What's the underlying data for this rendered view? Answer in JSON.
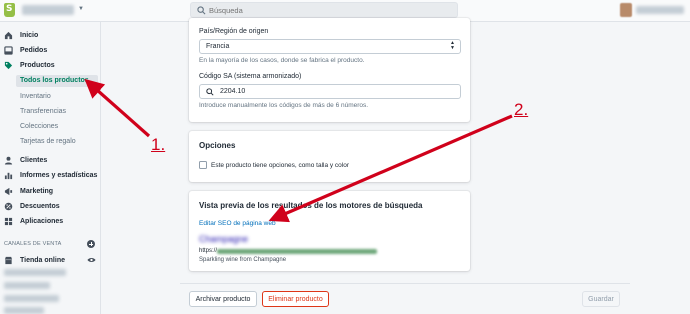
{
  "topbar": {
    "search_placeholder": "Búsqueda"
  },
  "sidebar": {
    "items": [
      {
        "label": "Inicio",
        "icon": "home-icon"
      },
      {
        "label": "Pedidos",
        "icon": "orders-icon"
      },
      {
        "label": "Productos",
        "icon": "tag-icon"
      }
    ],
    "product_subitems": [
      "Todos los productos",
      "Inventario",
      "Transferencias",
      "Colecciones",
      "Tarjetas de regalo"
    ],
    "items_after": [
      {
        "label": "Clientes",
        "icon": "customers-icon"
      },
      {
        "label": "Informes y estadísticas",
        "icon": "analytics-icon"
      },
      {
        "label": "Marketing",
        "icon": "marketing-icon"
      },
      {
        "label": "Descuentos",
        "icon": "discounts-icon"
      },
      {
        "label": "Aplicaciones",
        "icon": "apps-icon"
      }
    ],
    "channels_title": "CANALES DE VENTA",
    "channel_online_store": "Tienda online"
  },
  "customs": {
    "country_label": "País/Región de origen",
    "country_value": "Francia",
    "country_help": "En la mayoría de los casos, donde se fabrica el producto.",
    "hs_label": "Código SA (sistema armonizado)",
    "hs_value": "2204.10",
    "hs_help": "Introduce manualmente los códigos de más de 6 números."
  },
  "options": {
    "title": "Opciones",
    "checkbox_label": "Este producto tiene opciones, como talla y color",
    "checked": false
  },
  "seo": {
    "title": "Vista previa de los resultados de los motores de búsqueda",
    "edit_link": "Editar SEO de página web",
    "preview_title": "Champagne",
    "preview_url_prefix": "https://",
    "preview_description": "Sparkling wine from Champagne"
  },
  "footer": {
    "archive_label": "Archivar producto",
    "delete_label": "Eliminar producto",
    "save_label": "Guardar"
  },
  "annotations": {
    "label_1": "1.",
    "label_2": "2.",
    "color": "#d0011b"
  },
  "colors": {
    "active_nav": "#008060",
    "link": "#006fbb",
    "destructive": "#de3618"
  }
}
